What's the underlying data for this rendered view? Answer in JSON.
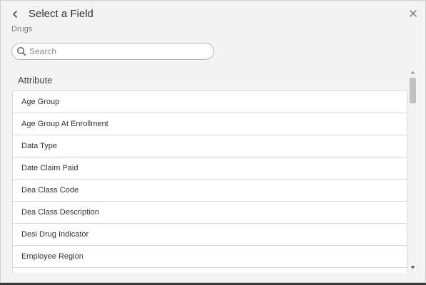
{
  "dialog": {
    "title": "Select a Field",
    "subtitle": "Drugs",
    "back_icon": "chevron-left-icon",
    "close_icon": "close-icon"
  },
  "search": {
    "placeholder": "Search",
    "value": "",
    "icon": "search-icon"
  },
  "section": {
    "label": "Attribute"
  },
  "items": [
    {
      "label": "Age Group"
    },
    {
      "label": "Age Group At Enrollment"
    },
    {
      "label": "Data Type"
    },
    {
      "label": "Date Claim Paid"
    },
    {
      "label": "Dea Class Code"
    },
    {
      "label": "Dea Class Description"
    },
    {
      "label": "Desi Drug Indicator"
    },
    {
      "label": "Employee Region"
    },
    {
      "label": ""
    }
  ],
  "colors": {
    "accent": "#3d5a80",
    "background": "#f3f3f3",
    "border": "#d8d8d8"
  }
}
